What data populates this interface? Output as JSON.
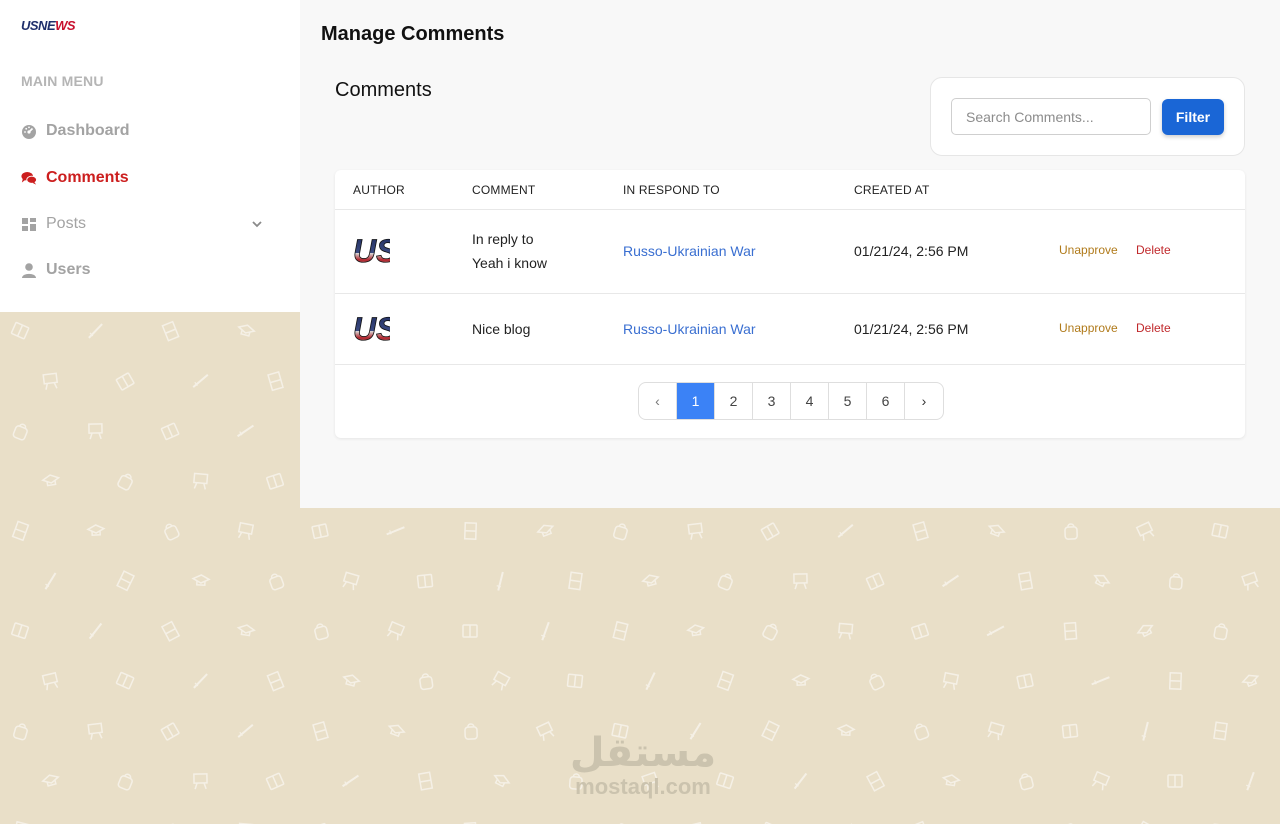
{
  "sidebar": {
    "logo": {
      "part1": "USNE",
      "part2": "WS"
    },
    "menu_heading": "MAIN MENU",
    "items": [
      {
        "label": "Dashboard",
        "icon": "gauge-icon"
      },
      {
        "label": "Comments",
        "icon": "comments-icon",
        "active": true
      },
      {
        "label": "Posts",
        "icon": "grid-icon",
        "expandable": true
      },
      {
        "label": "Users",
        "icon": "user-icon"
      }
    ]
  },
  "main": {
    "page_title": "Manage Comments",
    "section_title": "Comments",
    "search": {
      "placeholder": "Search Comments...",
      "value": ""
    },
    "filter_label": "Filter",
    "table": {
      "columns": [
        "AUTHOR",
        "COMMENT",
        "IN RESPOND TO",
        "CREATED AT"
      ],
      "rows": [
        {
          "author_avatar": "US",
          "comment_line1": "In reply to",
          "comment_line2": "Yeah i know",
          "respond_to": "Russo-Ukrainian War",
          "created_at": "01/21/24, 2:56 PM",
          "unapprove_label": "Unapprove",
          "delete_label": "Delete"
        },
        {
          "author_avatar": "US",
          "comment": "Nice blog",
          "respond_to": "Russo-Ukrainian War",
          "created_at": "01/21/24, 2:56 PM",
          "unapprove_label": "Unapprove",
          "delete_label": "Delete"
        }
      ]
    },
    "pagination": {
      "prev": "‹",
      "pages": [
        "1",
        "2",
        "3",
        "4",
        "5",
        "6"
      ],
      "current": "1",
      "next": "›"
    }
  },
  "watermark": {
    "arabic": "مستقل",
    "latin": "mostaql.com"
  },
  "colors": {
    "accent": "#cc1e1e",
    "primary_button": "#1a66d6",
    "active_page": "#3b82f6",
    "link": "#3a6fd1",
    "unapprove": "#b07a1a",
    "delete": "#c0282b",
    "background": "#e9dfc8"
  }
}
